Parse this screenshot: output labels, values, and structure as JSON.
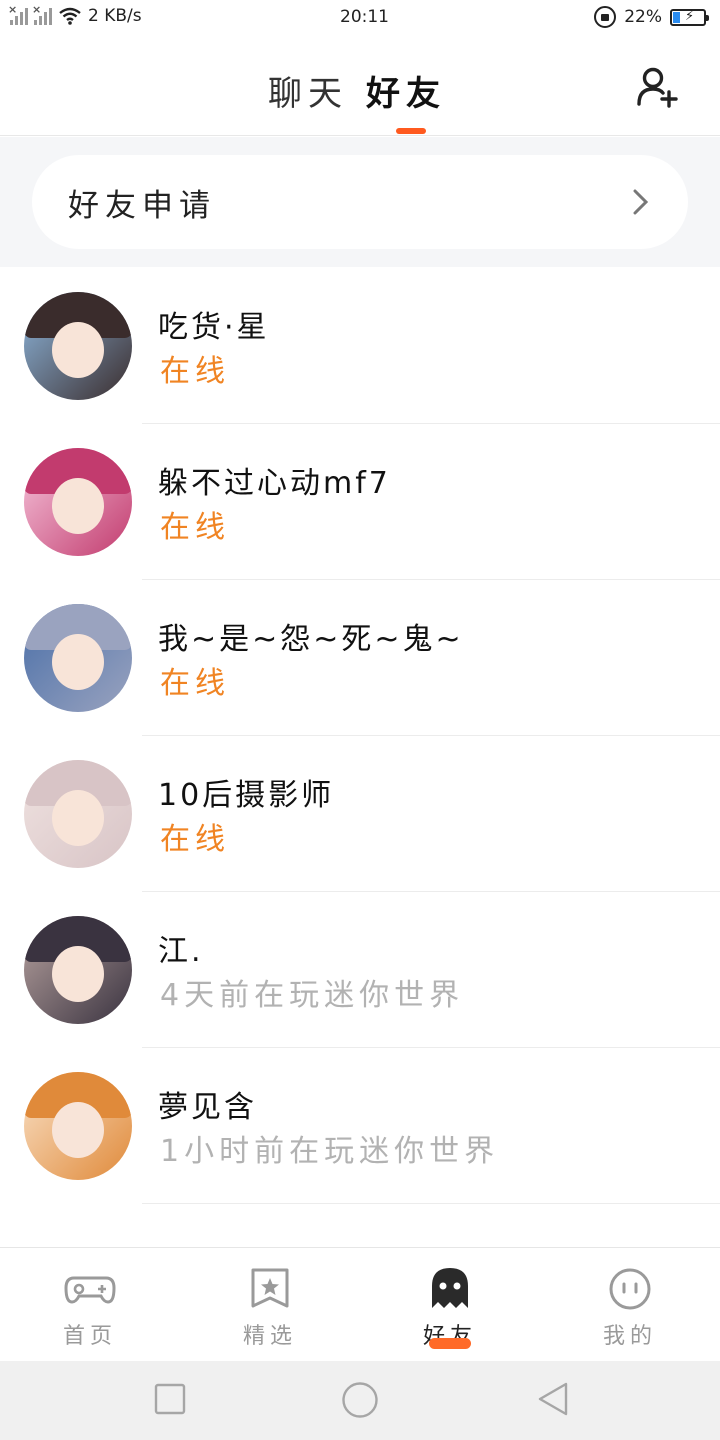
{
  "status_bar": {
    "net_speed": "2 KB/s",
    "time": "20:11",
    "battery_pct": "22%",
    "battery_level": 0.22
  },
  "header": {
    "tab_chat": "聊天",
    "tab_friends": "好友",
    "active_tab": "好友",
    "add_friend_icon": "add-user-icon"
  },
  "friend_requests": {
    "label": "好友申请",
    "chevron_icon": "chevron-right-icon"
  },
  "friends": [
    {
      "name": "吃货·星",
      "status": "在线",
      "online": true,
      "avatar_colors": [
        "#3a2c2c",
        "#8fb9e0"
      ]
    },
    {
      "name": "躲不过心动mf7",
      "status": "在线",
      "online": true,
      "avatar_colors": [
        "#c23b6e",
        "#f6c7dd"
      ]
    },
    {
      "name": "我~是~怨~死~鬼~",
      "status": "在线",
      "online": true,
      "avatar_colors": [
        "#9aa3bf",
        "#4a6fa8"
      ]
    },
    {
      "name": "10后摄影师",
      "status": "在线",
      "online": true,
      "avatar_colors": [
        "#d8c4c6",
        "#efe2e0"
      ]
    },
    {
      "name": "江.",
      "status": "4天前在玩迷你世界",
      "online": false,
      "avatar_colors": [
        "#3a3340",
        "#b8a3a0"
      ]
    },
    {
      "name": "夢见含",
      "status": "1小时前在玩迷你世界",
      "online": false,
      "avatar_colors": [
        "#e08a3a",
        "#f9e1c7"
      ]
    }
  ],
  "bottom_nav": {
    "items": [
      {
        "label": "首页",
        "icon": "gamepad-icon"
      },
      {
        "label": "精选",
        "icon": "star-bookmark-icon"
      },
      {
        "label": "好友",
        "icon": "ghost-icon"
      },
      {
        "label": "我的",
        "icon": "face-icon"
      }
    ],
    "active": "好友"
  },
  "system_nav": {
    "buttons": [
      "recent-apps-icon",
      "home-icon",
      "back-icon"
    ]
  },
  "colors": {
    "accent": "#ff5a1f",
    "online": "#f08423",
    "offline": "#b2b2b2"
  }
}
